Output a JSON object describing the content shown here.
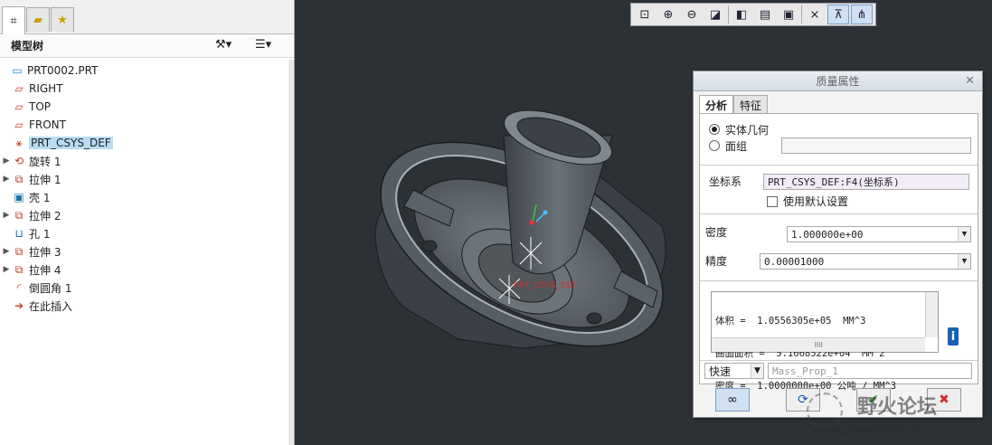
{
  "left_panel": {
    "tabs": [
      "model-tree-tab",
      "folder-browser-tab",
      "favorites-tab"
    ],
    "header": {
      "title": "模型树"
    },
    "tree": [
      {
        "label": "PRT0002.PRT",
        "icon": "part-icon",
        "expandable": false,
        "selected": false,
        "indent": 0
      },
      {
        "label": "RIGHT",
        "icon": "datum-plane-icon",
        "expandable": false,
        "selected": false,
        "indent": 1
      },
      {
        "label": "TOP",
        "icon": "datum-plane-icon",
        "expandable": false,
        "selected": false,
        "indent": 1
      },
      {
        "label": "FRONT",
        "icon": "datum-plane-icon",
        "expandable": false,
        "selected": false,
        "indent": 1
      },
      {
        "label": "PRT_CSYS_DEF",
        "icon": "csys-icon",
        "expandable": false,
        "selected": true,
        "indent": 1
      },
      {
        "label": "旋转 1",
        "icon": "revolve-icon",
        "expandable": true,
        "selected": false,
        "indent": 1
      },
      {
        "label": "拉伸 1",
        "icon": "extrude-icon",
        "expandable": true,
        "selected": false,
        "indent": 1
      },
      {
        "label": "壳 1",
        "icon": "shell-icon",
        "expandable": false,
        "selected": false,
        "indent": 1
      },
      {
        "label": "拉伸 2",
        "icon": "extrude-icon",
        "expandable": true,
        "selected": false,
        "indent": 1
      },
      {
        "label": "孔 1",
        "icon": "hole-icon",
        "expandable": false,
        "selected": false,
        "indent": 1
      },
      {
        "label": "拉伸 3",
        "icon": "extrude-icon",
        "expandable": true,
        "selected": false,
        "indent": 1
      },
      {
        "label": "拉伸 4",
        "icon": "extrude-icon",
        "expandable": true,
        "selected": false,
        "indent": 1
      },
      {
        "label": "倒圆角 1",
        "icon": "round-icon",
        "expandable": false,
        "selected": false,
        "indent": 1
      },
      {
        "label": "在此插入",
        "icon": "insert-here-arrow-icon",
        "expandable": false,
        "selected": false,
        "indent": 1
      }
    ]
  },
  "view_toolbar": {
    "buttons": [
      {
        "name": "refit-icon",
        "glyph": "⊡"
      },
      {
        "name": "zoom-in-icon",
        "glyph": "⊕"
      },
      {
        "name": "zoom-out-icon",
        "glyph": "⊖"
      },
      {
        "name": "repaint-icon",
        "glyph": "◪"
      },
      {
        "name": "display-style-icon",
        "glyph": "◧"
      },
      {
        "name": "saved-views-icon",
        "glyph": "▤"
      },
      {
        "name": "view-manager-icon",
        "glyph": "▣"
      },
      {
        "name": "datum-display-icon",
        "glyph": "⨯"
      },
      {
        "name": "csys-display-icon",
        "glyph": "⊼"
      },
      {
        "name": "spin-center-icon",
        "glyph": "⋔"
      }
    ]
  },
  "viewport": {
    "csys_label": "PRT_CSYS_DEF"
  },
  "dialog": {
    "title": "质量属性",
    "tabs": [
      "分析",
      "特征"
    ],
    "active_tab": "分析",
    "geometry_options": [
      {
        "label": "实体几何",
        "checked": true
      },
      {
        "label": "面组",
        "checked": false
      }
    ],
    "csys_label": "坐标系",
    "csys_value": "PRT_CSYS_DEF:F4(坐标系)",
    "use_default_label": "使用默认设置",
    "use_default_checked": false,
    "density_label": "密度",
    "density_value": "1.000000e+00",
    "accuracy_label": "精度",
    "accuracy_value": "0.00001000",
    "results": [
      "体积 =  1.0556305e+05  MM^3",
      "曲面面积 =  5.1668522e+04  MM^2",
      "密度 =  1.0000000e+00 公吨 / MM^3"
    ],
    "results_hscroll_text": "IIII",
    "mode_value": "快速",
    "name_placeholder": "Mass_Prop_1",
    "footer_buttons": [
      "preview-icon",
      "repeat-icon",
      "ok-check-icon",
      "cancel-x-icon"
    ]
  },
  "watermark": {
    "text_main": "野火论坛",
    "text_url": "www.proewildfire.cn"
  },
  "colors": {
    "viewport_bg": "#2c3136",
    "selected_bg": "#b9dcf4",
    "accent_red": "#c04020",
    "info_blue": "#1b5fb3",
    "ok_green": "#2f9a2f",
    "cancel_red": "#c83232"
  }
}
